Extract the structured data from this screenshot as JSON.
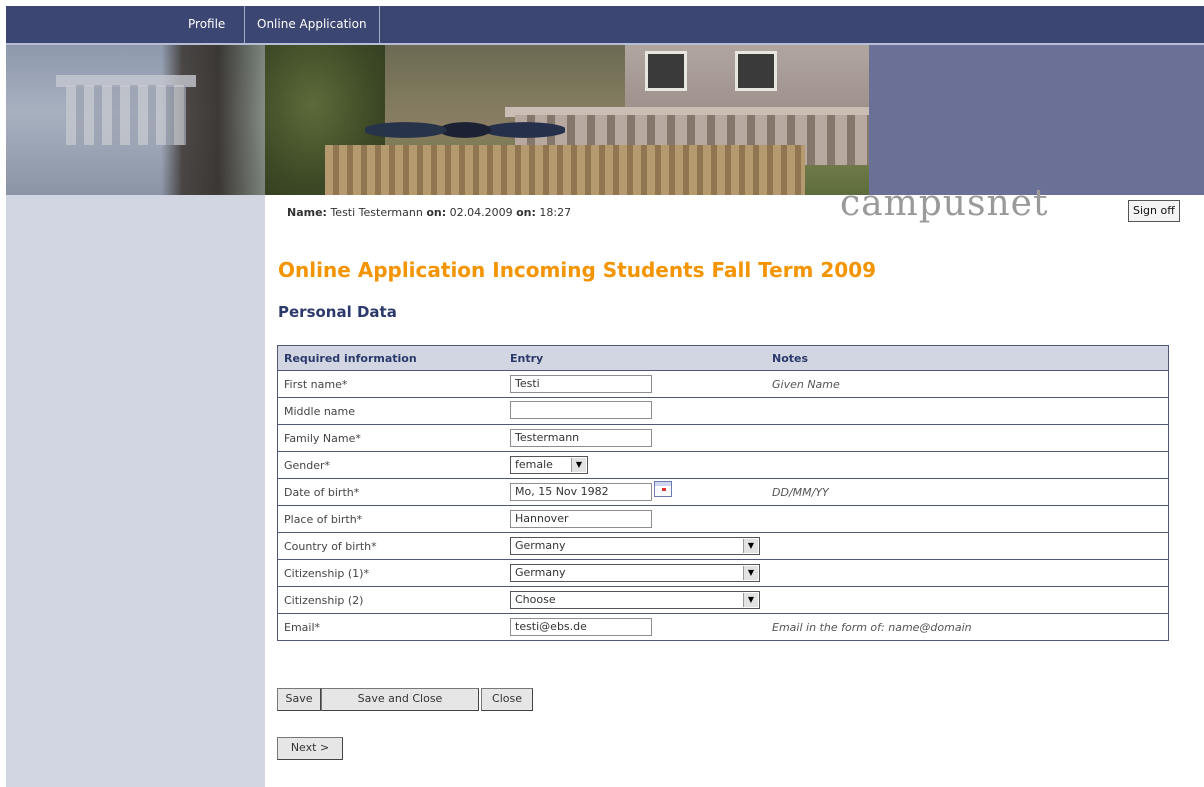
{
  "nav": {
    "tabs": [
      {
        "label": "Profile"
      },
      {
        "label": "Online Application"
      }
    ]
  },
  "header": {
    "name_label": "Name:",
    "name_value": "Testi Testermann",
    "on_label_1": "on:",
    "date_value": "02.04.2009",
    "on_label_2": "on:",
    "time_value": "18:27",
    "logo_text": "campusnet",
    "signoff_label": "Sign off"
  },
  "page": {
    "title": "Online Application Incoming Students Fall Term 2009",
    "section": "Personal Data"
  },
  "table": {
    "headers": [
      "Required information",
      "Entry",
      "Notes"
    ],
    "rows": [
      {
        "label": "First name*",
        "value": "Testi",
        "note": "Given Name"
      },
      {
        "label": "Middle name",
        "value": "",
        "note": ""
      },
      {
        "label": "Family Name*",
        "value": "Testermann",
        "note": ""
      },
      {
        "label": "Gender*",
        "value": "female",
        "note": ""
      },
      {
        "label": "Date of birth*",
        "value": "Mo, 15 Nov 1982",
        "note": "DD/MM/YY"
      },
      {
        "label": "Place of birth*",
        "value": "Hannover",
        "note": ""
      },
      {
        "label": "Country of birth*",
        "value": "Germany",
        "note": ""
      },
      {
        "label": "Citizenship (1)*",
        "value": "Germany",
        "note": ""
      },
      {
        "label": "Citizenship (2)",
        "value": "Choose",
        "note": ""
      },
      {
        "label": "Email*",
        "value": "testi@ebs.de",
        "note": "Email in the form of: name@domain"
      }
    ]
  },
  "buttons": {
    "save": "Save",
    "save_close": "Save and Close",
    "close": "Close",
    "next": "Next >"
  },
  "icons": {
    "select_arrow": "dropdown-arrow-icon",
    "calendar": "calendar-icon"
  },
  "colors": {
    "nav_bg": "#3b4673",
    "title_orange": "#f39400",
    "section_blue": "#2c3a6b",
    "sidebar_bg": "#d1d6e2"
  }
}
